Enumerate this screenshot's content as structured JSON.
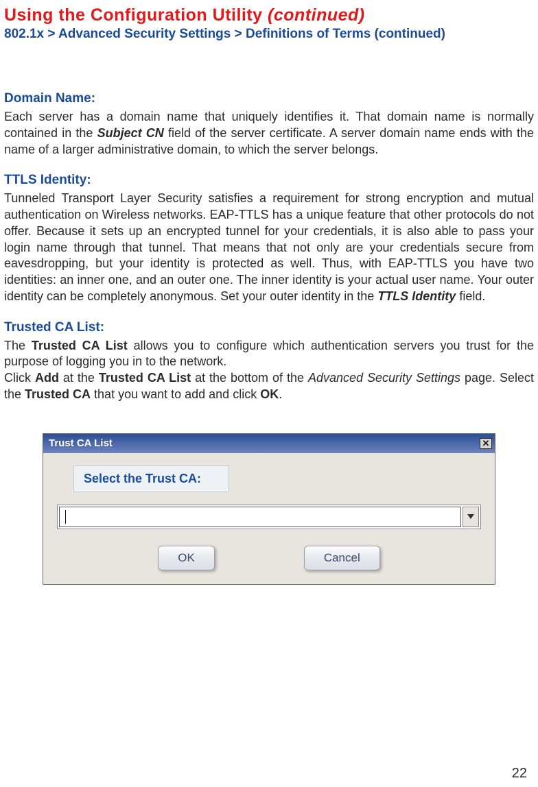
{
  "header": {
    "title_main": "Using the Configuration Utility ",
    "title_continued": "(continued)",
    "breadcrumb": "802.1x > Advanced Security Settings > Definitions of Terms (continued)"
  },
  "sections": {
    "domain": {
      "heading": "Domain Name:",
      "p1a": "Each server has a domain name that uniquely identifies it. That domain name is normally contained in the ",
      "p1b": "Subject CN",
      "p1c": " field of the server certificate. A server domain name ends with the name of a larger administrative domain, to which the server belongs."
    },
    "ttls": {
      "heading": "TTLS Identity:",
      "p1a": "Tunneled Transport Layer Security satisfies a requirement for strong encryption and mutual authentication on Wireless networks. EAP-TTLS has a unique feature that other protocols do not offer. Because it sets up an encrypted tunnel for your credentials, it is also able to pass your login name through that tunnel. That means that not only are your credentials secure from eavesdropping, but your identity is protected as well. Thus, with EAP-TTLS you have two identities: an inner one, and an outer one. The inner identity is your actual user name. Your outer identity can be completely anonymous. Set your outer identity in the ",
      "p1b": "TTLS Identity",
      "p1c": " field."
    },
    "trusted": {
      "heading": "Trusted CA List:",
      "p1a": "The ",
      "p1b": "Trusted CA List",
      "p1c": " allows you to configure which authentication servers you trust for the purpose of logging you in to the network.",
      "p2a": "Click ",
      "p2b": "Add",
      "p2c": " at the ",
      "p2d": "Trusted CA List",
      "p2e": " at the bottom of the ",
      "p2f": "Advanced Security Settings",
      "p2g": " page. Select the ",
      "p2h": "Trusted CA",
      "p2i": " that you want to add and click ",
      "p2j": "OK",
      "p2k": "."
    }
  },
  "dialog": {
    "title": "Trust CA List",
    "label": "Select the Trust CA:",
    "selected_value": "",
    "buttons": {
      "ok": "OK",
      "cancel": "Cancel"
    }
  },
  "page_number": "22"
}
